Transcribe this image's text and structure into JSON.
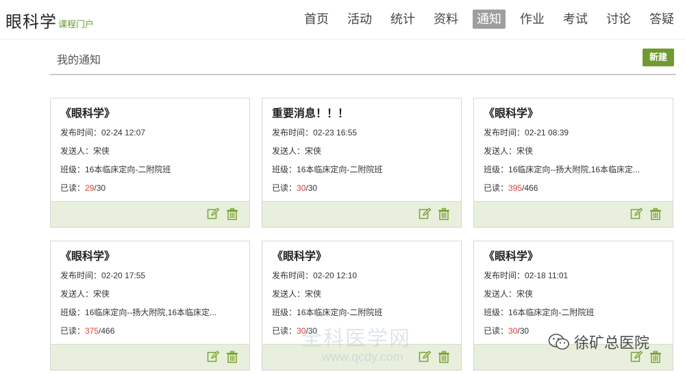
{
  "header": {
    "logo_main": "眼科学",
    "logo_sub": "课程门户",
    "nav": [
      "首页",
      "活动",
      "统计",
      "资料",
      "通知",
      "作业",
      "考试",
      "讨论",
      "答疑"
    ],
    "active_nav": "通知"
  },
  "section": {
    "title": "我的通知",
    "new_button": "新建"
  },
  "labels": {
    "time": "发布时间：",
    "sender": "发送人：",
    "class": "班级：",
    "read": "已读："
  },
  "cards": [
    {
      "title": "《眼科学》",
      "time": "02-24 12:07",
      "sender": "宋侠",
      "class": "16本临床定向-二附院班",
      "read": "29",
      "total": "/30"
    },
    {
      "title": "重要消息！！！",
      "time": "02-23 16:55",
      "sender": "宋侠",
      "class": "16本临床定向-二附院班",
      "read": "30",
      "total": "/30"
    },
    {
      "title": "《眼科学》",
      "time": "02-21 08:39",
      "sender": "宋侠",
      "class": "16临床定向--扬大附院,16本临床定...",
      "read": "395",
      "total": "/466"
    },
    {
      "title": "《眼科学》",
      "time": "02-20 17:55",
      "sender": "宋侠",
      "class": "16临床定向--扬大附院,16本临床定...",
      "read": "375",
      "total": "/466"
    },
    {
      "title": "《眼科学》",
      "time": "02-20 12:10",
      "sender": "宋侠",
      "class": "16本临床定向-二附院班",
      "read": "30",
      "total": "/30"
    },
    {
      "title": "《眼科学》",
      "time": "02-18 11:01",
      "sender": "宋侠",
      "class": "16本临床定向-二附院班",
      "read": "30",
      "total": "/30"
    }
  ],
  "watermark": {
    "account": "徐矿总医院",
    "faint_title": "全科医学网",
    "faint_url": "www.qcdy.com"
  },
  "colors": {
    "accent": "#6f9a2f",
    "footer_bg": "#e8efdc",
    "read_red": "#e03c2e",
    "active_nav_bg": "#9e9e9e"
  }
}
